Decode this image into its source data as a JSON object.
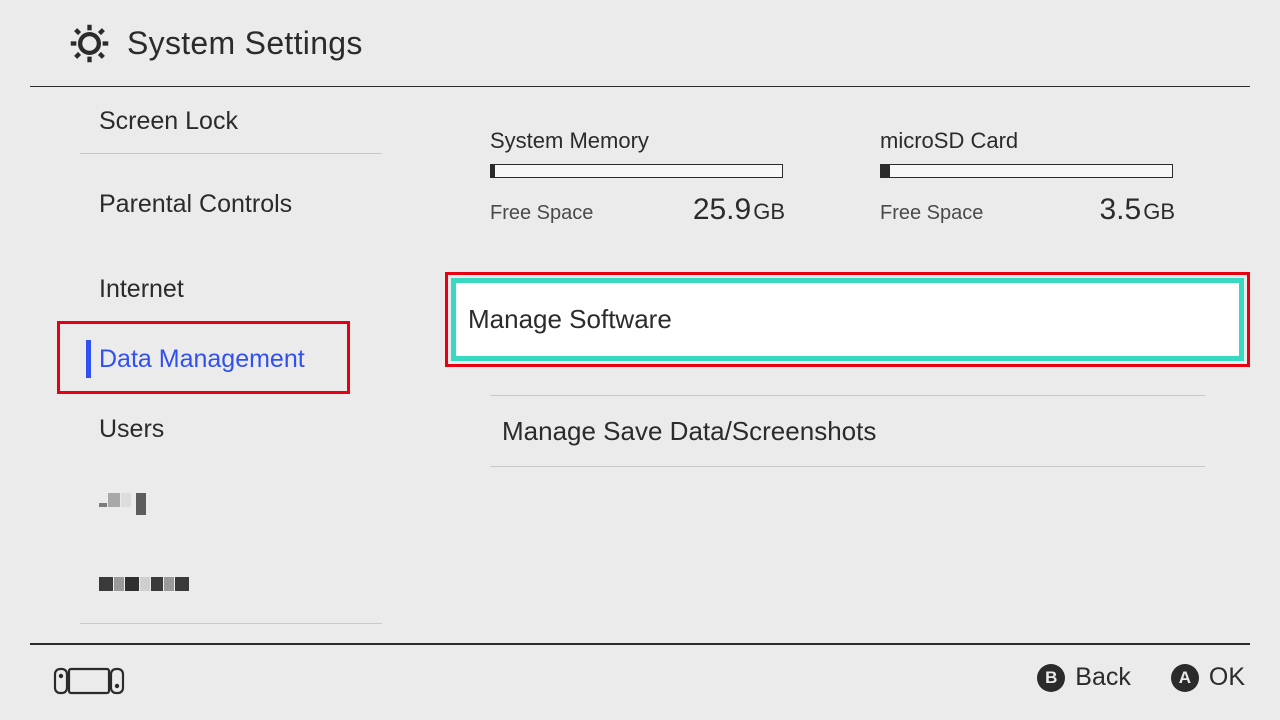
{
  "header": {
    "title": "System Settings"
  },
  "sidebar": {
    "items": [
      {
        "label": "Screen Lock"
      },
      {
        "label": "Parental Controls"
      },
      {
        "label": "Internet"
      },
      {
        "label": "Data Management",
        "selected": true
      },
      {
        "label": "Users"
      }
    ]
  },
  "storage": [
    {
      "title": "System Memory",
      "used_fraction": 0.01,
      "free_label": "Free Space",
      "free_value": "25.9",
      "free_unit": "GB"
    },
    {
      "title": "microSD Card",
      "used_fraction": 0.02,
      "free_label": "Free Space",
      "free_value": "3.5",
      "free_unit": "GB"
    }
  ],
  "menu": {
    "items": [
      {
        "label": "Manage Software",
        "focused": true
      },
      {
        "label": "Manage Save Data/Screenshots",
        "focused": false
      }
    ]
  },
  "footer": {
    "back_letter": "B",
    "back_label": "Back",
    "ok_letter": "A",
    "ok_label": "OK"
  },
  "colors": {
    "accent": "#3050f0",
    "highlight_border": "#38d9c0",
    "annotation": "#e60012"
  }
}
